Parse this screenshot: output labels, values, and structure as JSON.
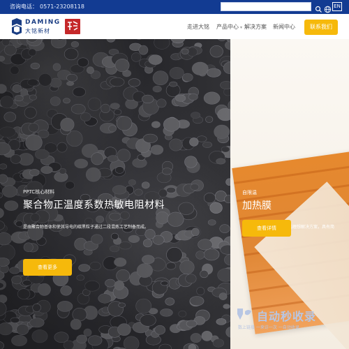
{
  "topbar": {
    "phone_label": "咨询电话：",
    "phone_number": "0571-23208118",
    "search_placeholder": "",
    "lang_button": "EN"
  },
  "header": {
    "logo_en": "DAMING",
    "logo_cn": "大铭新材",
    "nav": [
      {
        "label": "走进大铭"
      },
      {
        "label": "产品中心"
      },
      {
        "label": "解决方案"
      },
      {
        "label": "新闻中心"
      }
    ],
    "contact_button": "联系我们"
  },
  "hero_left": {
    "subtitle": "PPTC核心材料",
    "title": "聚合物正温度系数热敏电阻材料",
    "description": "是由聚合物基体和使其导电的碳黑粒子通过二段混炼工艺制备而成。",
    "button": "查看更多"
  },
  "hero_right": {
    "subtitle": "自限温",
    "title": "加热膜",
    "description": "是目前多种供热加热应用的理想解决方案，具有简单、稳定、安全的特点。",
    "button": "查看详情"
  },
  "watermark": {
    "main": "自动秒收录",
    "sub": "数上链接 一来访一次 一自动收录"
  },
  "colors": {
    "topbar": "#123b92",
    "accent": "#f6b90b",
    "logo": "#1a3d83"
  },
  "icons": {
    "search": "search-icon",
    "globe": "globe-icon",
    "caret": "caret-down-icon"
  }
}
